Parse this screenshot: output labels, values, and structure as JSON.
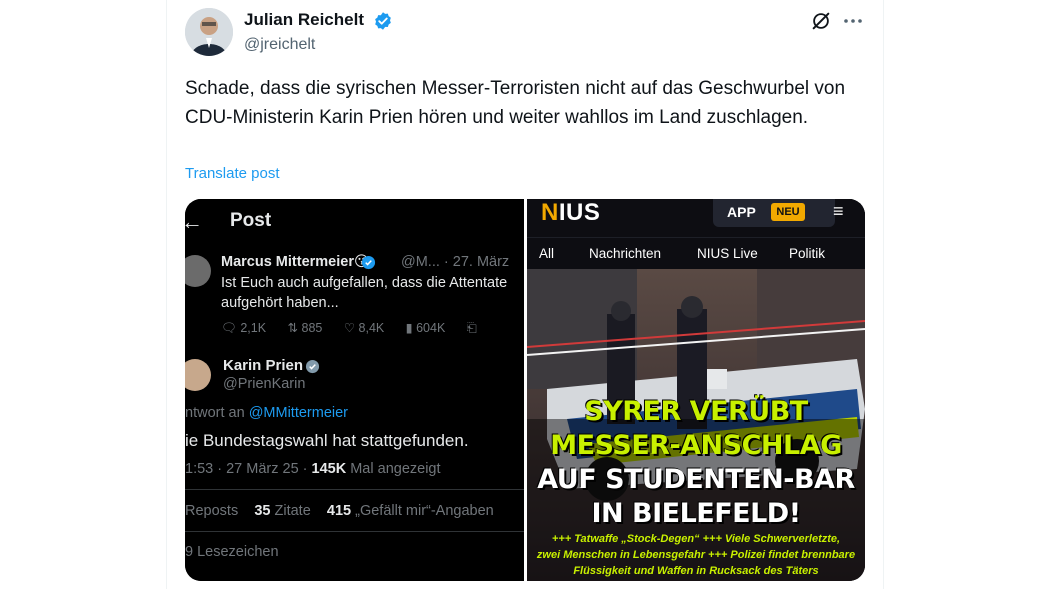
{
  "tweet": {
    "author_name": "Julian Reichelt",
    "author_handle": "@jreichelt",
    "text": "Schade, dass die syrischen Messer-Terroristen nicht auf das Geschwurbel von CDU-Ministerin Karin Prien hören und weiter wahllos im Land zuschlagen.",
    "translate_label": "Translate post",
    "icons": {
      "verified": "verified-badge-icon",
      "grok": "grok-icon",
      "more": "more-dots-icon"
    },
    "accent_color": "#1d9bf0"
  },
  "screenshot_left": {
    "header_title": "Post",
    "quoted": {
      "name": "Marcus Mittermeier😘",
      "meta": "@M... · 27. März",
      "text": "Ist Euch auch aufgefallen, dass die Attentate aufgehört haben...",
      "replies": "2,1K",
      "reposts": "885",
      "likes": "8,4K",
      "views": "604K"
    },
    "reply": {
      "name": "Karin Prien",
      "handle": "@PrienKarin",
      "reply_prefix": "ntwort an",
      "reply_mention": "@MMittermeier",
      "text": "ie Bundestagswahl  hat stattgefunden.",
      "time": "1:53 · 27 März 25 · ",
      "views_count": "145K",
      "views_label": " Mal angezeigt",
      "reposts_label": "Reposts",
      "quotes_count": "35",
      "quotes_label": "Zitate",
      "likes_count": "415",
      "likes_label": "„Gefällt mir“-Angaben",
      "bookmarks": "9 Lesezeichen"
    }
  },
  "screenshot_right": {
    "logo_prefix": "N",
    "logo_rest": "IUS",
    "app_label": "APP",
    "new_badge": "NEU",
    "nav": [
      "All",
      "Nachrichten",
      "NIUS Live",
      "Politik"
    ],
    "headline_line1": "SYRER VERÜBT",
    "headline_line2": "MESSER-ANSCHLAG",
    "headline_line3": "AUF STUDENTEN-BAR",
    "headline_line4": "IN BIELEFELD!",
    "sub_line1": "+++ Tatwaffe „Stock-Degen“ +++ Viele Schwerverletzte,",
    "sub_line2": "zwei Menschen in Lebensgefahr +++ Polizei findet brennbare",
    "sub_line3": "Flüssigkeit und Waffen in Rucksack des Täters",
    "accent_color": "#c8f000"
  }
}
